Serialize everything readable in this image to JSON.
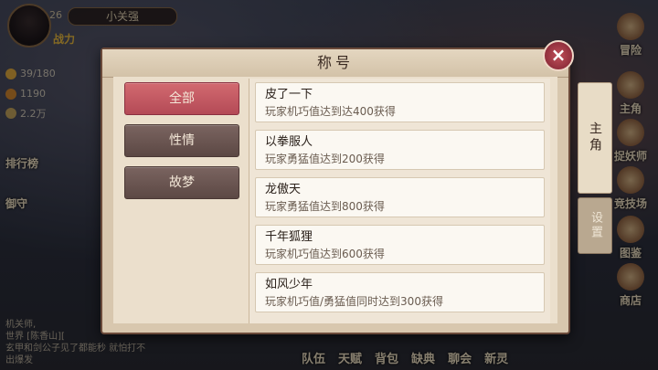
{
  "player": {
    "level": "26",
    "name": "小关强",
    "power_label": "战力"
  },
  "resources": [
    "39/180",
    "1190",
    "2.2万"
  ],
  "right_menu": [
    "冒险",
    "主角",
    "捉妖师",
    "竞技场",
    "图鉴",
    "商店"
  ],
  "left_menu": [
    "排行榜",
    "御守"
  ],
  "bottom_menu": [
    "队伍",
    "天赋",
    "背包",
    "缺典",
    "聊会",
    "新灵"
  ],
  "chat": {
    "line1": "机关师,",
    "line2": "世界 [陈香山][",
    "line3": "玄甲和剑公子见了都能秒 就怕打不",
    "line4": "出爆发"
  },
  "dialog": {
    "title": "称号",
    "close": "×",
    "tabs": [
      "全部",
      "性情",
      "故梦"
    ],
    "side_tabs": [
      "主角",
      "设置"
    ],
    "titles": [
      {
        "name": "皮了一下",
        "desc": "玩家机巧值达到达400获得"
      },
      {
        "name": "以拳服人",
        "desc": "玩家勇猛值达到200获得"
      },
      {
        "name": "龙傲天",
        "desc": "玩家勇猛值达到800获得"
      },
      {
        "name": "千年狐狸",
        "desc": "玩家机巧值达到600获得"
      },
      {
        "name": "如风少年",
        "desc": "玩家机巧值/勇猛值同时达到300获得"
      }
    ]
  }
}
